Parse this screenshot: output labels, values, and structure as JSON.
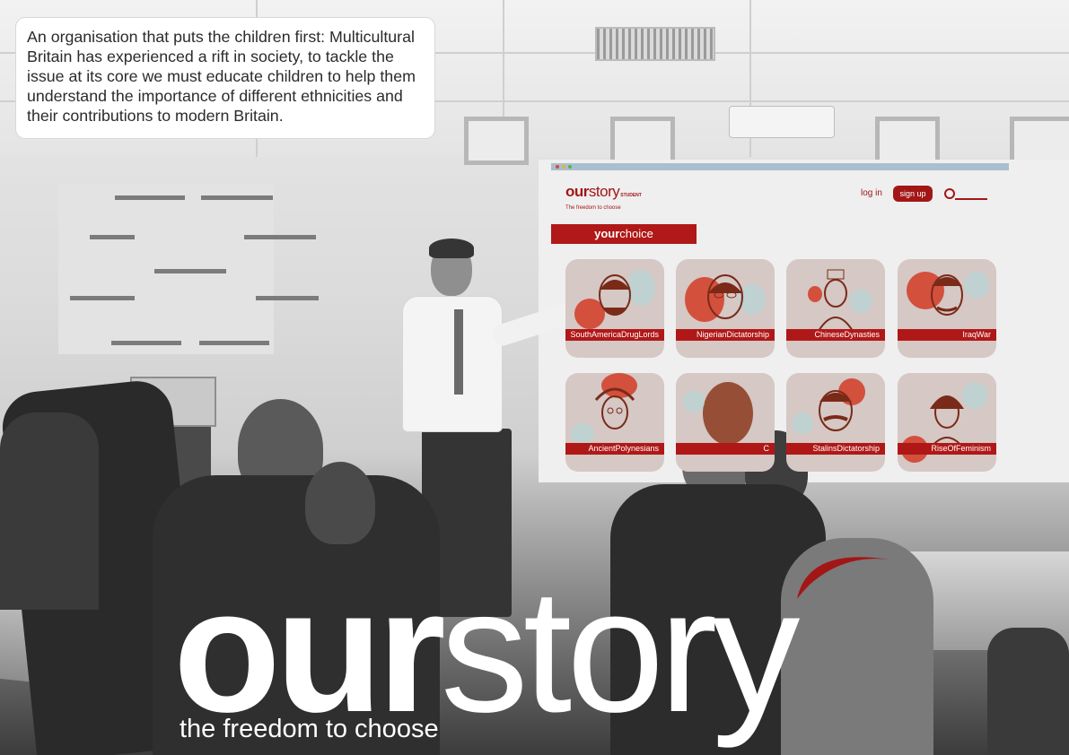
{
  "intro": {
    "text": "An organisation that puts the children first: Multicultural Britain has experienced a rift in society, to tackle the issue at its core we must educate children to help them understand the importance of different ethnicities and their contributions to modern Britain."
  },
  "site": {
    "logo_bold": "our",
    "logo_light": "story",
    "logo_badge": "STUDENT",
    "tagline": "The freedom to choose",
    "login_label": "log in",
    "signup_label": "sign up",
    "section_bold": "your",
    "section_light": "choice",
    "cards": [
      {
        "label": "SouthAmericaDrugLords"
      },
      {
        "label": "NigerianDictatorship"
      },
      {
        "label": "ChineseDynasties"
      },
      {
        "label": "IraqWar"
      },
      {
        "label": "AncientPolynesians"
      },
      {
        "label": "C"
      },
      {
        "label": "StalinsDictatorship"
      },
      {
        "label": "RiseOfFeminism"
      }
    ]
  },
  "brand": {
    "our": "our",
    "story": "story",
    "tagline": "the freedom to choose"
  },
  "colors": {
    "brand_red": "#a31616",
    "label_red": "#b01818",
    "card_bg": "#d5c8c5",
    "browser_bar": "#a9bfd0"
  },
  "icons": [
    "search-icon",
    "swoosh-icon"
  ]
}
